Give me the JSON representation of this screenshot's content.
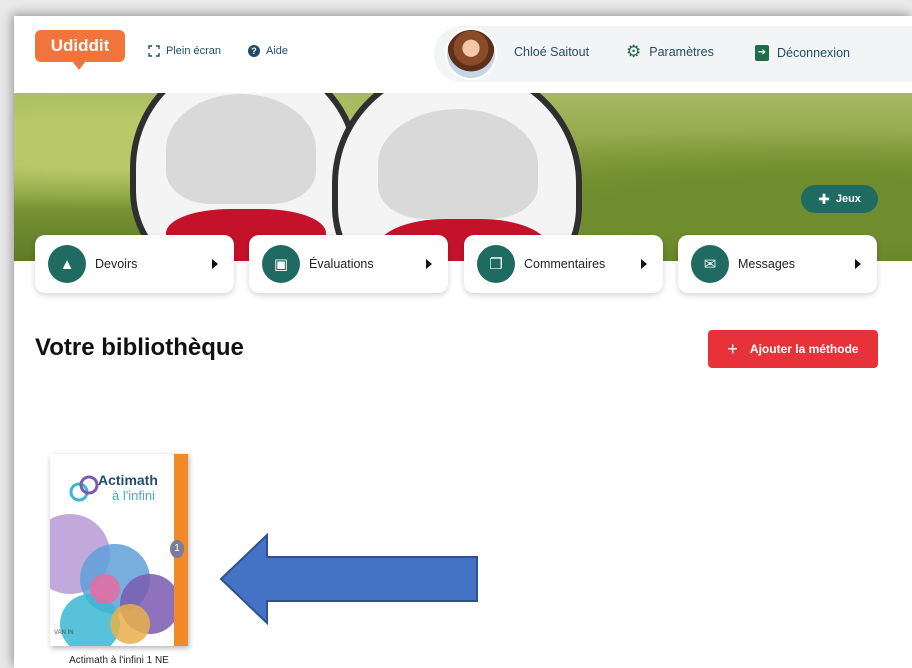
{
  "header": {
    "logo": "Udiddit",
    "fullscreen_label": "Plein écran",
    "help_label": "Aide",
    "user_name": "Chloé Saitout",
    "settings_label": "Paramètres",
    "logout_label": "Déconnexion"
  },
  "hero": {
    "games_label": "Jeux"
  },
  "actions": [
    {
      "label": "Devoirs",
      "icon": "bag-icon"
    },
    {
      "label": "Évaluations",
      "icon": "evaluation-icon"
    },
    {
      "label": "Commentaires",
      "icon": "comments-icon"
    },
    {
      "label": "Messages",
      "icon": "mail-icon"
    }
  ],
  "library": {
    "title": "Votre bibliothèque",
    "add_button": "Ajouter la méthode",
    "books": [
      {
        "cover_title_1": "Actimath",
        "cover_title_2": "à l'infini",
        "cover_number": "1",
        "publisher": "VAN IN",
        "caption": "Actimath à l'infini 1 NE"
      }
    ]
  },
  "colors": {
    "brand": "#f0743c",
    "accent": "#1f6b61",
    "danger": "#e8323a",
    "arrow": "#4472c4"
  }
}
